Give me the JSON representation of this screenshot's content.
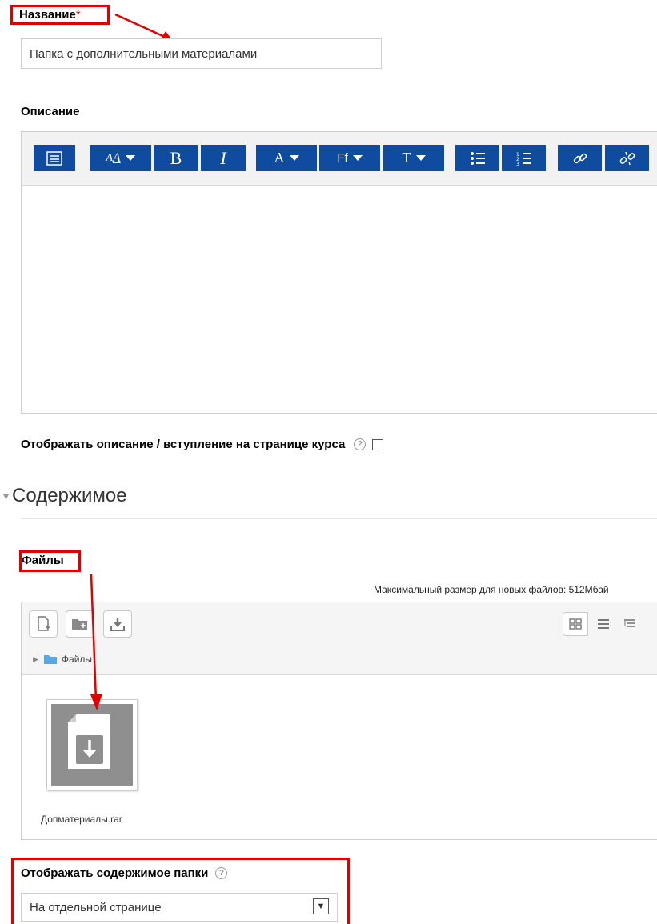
{
  "name_field": {
    "label": "Название",
    "required_mark": "*",
    "value": "Папка с дополнительными материалами"
  },
  "description": {
    "label": "Описание"
  },
  "editor_toolbar": {
    "buttons": [
      {
        "icon": "toolbar-toggle-icon"
      },
      {
        "icon": "font-size-icon",
        "text": "A"
      },
      {
        "icon": "bold-icon",
        "text": "B"
      },
      {
        "icon": "italic-icon",
        "text": "I"
      },
      {
        "icon": "font-color-icon",
        "text": "A"
      },
      {
        "icon": "font-family-icon",
        "text": "Ff"
      },
      {
        "icon": "text-style-icon",
        "text": "T"
      },
      {
        "icon": "bullet-list-icon"
      },
      {
        "icon": "numbered-list-icon"
      },
      {
        "icon": "link-icon"
      },
      {
        "icon": "unlink-icon"
      }
    ]
  },
  "show_description": {
    "label": "Отображать описание / вступление на странице курса",
    "help": "?"
  },
  "content_section": {
    "toggle": "▾",
    "title": "Содержимое"
  },
  "files": {
    "label": "Файлы",
    "max_size": "Максимальный размер для новых файлов: 512Мбай",
    "path_label": "Файлы",
    "items": [
      {
        "name": "Допматериалы.rar",
        "icon": "archive-file-icon"
      }
    ]
  },
  "display_mode": {
    "label": "Отображать содержимое папки",
    "help": "?",
    "selected": "На отдельной странице",
    "arrow": "▼"
  },
  "annotation_color": "#e00000",
  "accent": "#0f4b9f"
}
